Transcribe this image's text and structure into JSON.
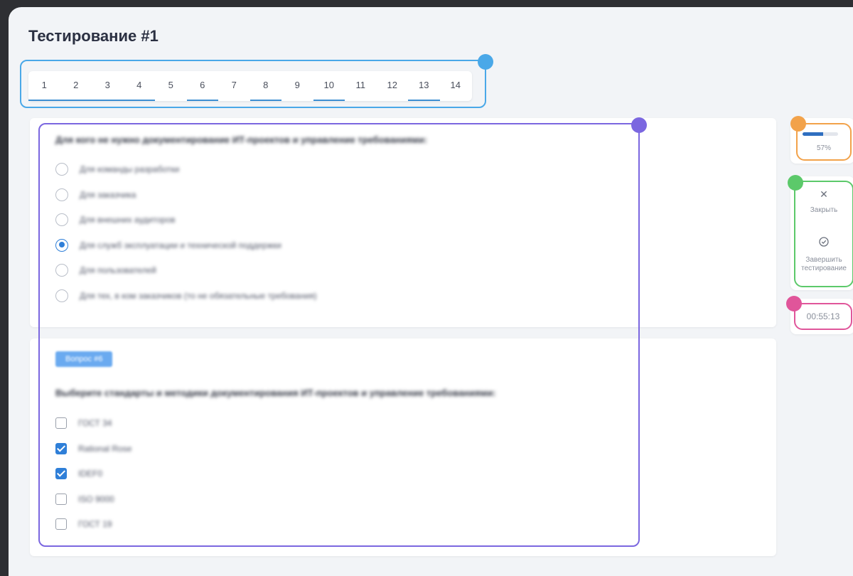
{
  "page": {
    "title": "Тестирование #1"
  },
  "navigator": {
    "numbers": [
      "1",
      "2",
      "3",
      "4",
      "5",
      "6",
      "7",
      "8",
      "9",
      "10",
      "11",
      "12",
      "13",
      "14"
    ],
    "answered": [
      1,
      2,
      3,
      4,
      6,
      8,
      10,
      13
    ]
  },
  "question_5": {
    "text": "Для кого не нужно документирование ИТ-проектов и управление требованиями:",
    "options": [
      "Для команды разработки",
      "Для заказчика",
      "Для внешних аудиторов",
      "Для служб эксплуатации и технической поддержки",
      "Для пользователей",
      "Для тех, в ком заказчиков (то не обязательные требования)"
    ],
    "selected_index": 3
  },
  "question_6": {
    "badge": "Вопрос #6",
    "text": "Выберите стандарты и методики документирования ИТ-проектов и управление требованиями:",
    "options": [
      "ГОСТ 34",
      "Rational Rose",
      "IDEF0",
      "ISO 9000",
      "ГОСТ 19"
    ],
    "checked": [
      false,
      true,
      true,
      false,
      false
    ]
  },
  "sidebar": {
    "progress_label": "57%",
    "progress_value": 0.57,
    "close_icon": "close-icon",
    "close_label": "Закрыть",
    "finish_icon": "check-circle-icon",
    "finish_label_1": "Завершить",
    "finish_label_2": "тестирование",
    "timer": "00:55:13"
  },
  "colors": {
    "nav_outline": "#4aa8e8",
    "question_outline": "#7b67e0",
    "progress_outline": "#f2a24a",
    "actions_outline": "#5cc96a",
    "timer_outline": "#e0559a",
    "accent": "#2f7fd8"
  }
}
